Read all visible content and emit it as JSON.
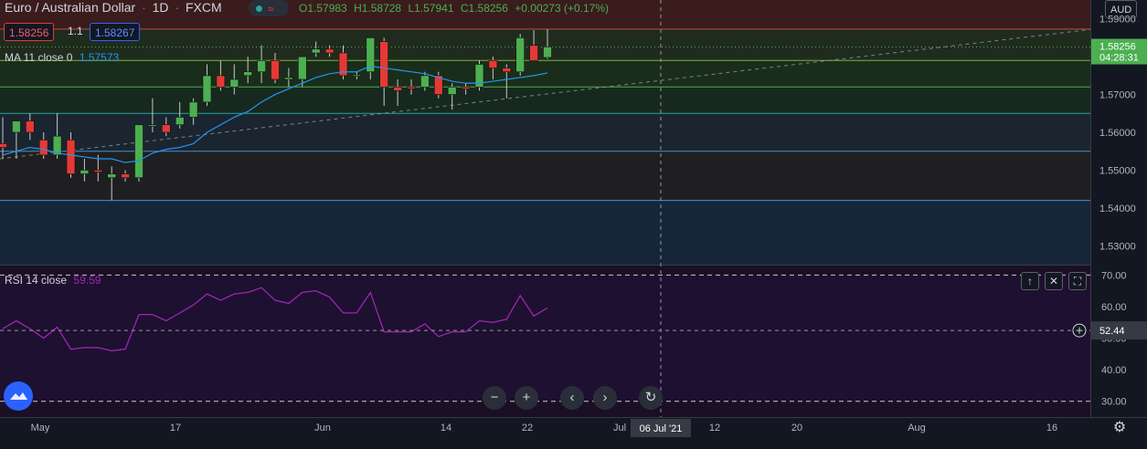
{
  "header": {
    "symbol": "Euro / Australian Dollar",
    "interval": "1D",
    "exchange": "FXCM",
    "ohlc": {
      "o": "O1.57983",
      "h": "H1.58728",
      "l": "L1.57941",
      "c": "C1.58256",
      "chg": "+0.00273 (+0.17%)"
    },
    "bid": "1.58256",
    "spread": "1.1",
    "ask": "1.58267",
    "currency": "AUD"
  },
  "ma_legend": {
    "label": "MA 11 close 0",
    "value": "1.57573"
  },
  "rsi_legend": {
    "label": "RSI 14 close",
    "value": "59.59"
  },
  "price_axis": {
    "last_price": "1.58256",
    "countdown": "04:28:31"
  },
  "rsi_axis": {
    "crosshair_value": "52.44"
  },
  "time_axis": {
    "crosshair_label": "06 Jul '21"
  },
  "colors": {
    "up": "#4caf50",
    "down": "#e53935",
    "ma": "#2196f3",
    "rsi": "#9c27b0",
    "bg": "#131722"
  },
  "icons": [
    "chevrons-up-icon",
    "close-icon",
    "maximize-icon",
    "zoom-out-icon",
    "zoom-in-icon",
    "scroll-left-icon",
    "scroll-right-icon",
    "reset-icon",
    "settings-icon",
    "logo-icon"
  ],
  "chart_data": [
    {
      "type": "candlestick",
      "title": "Euro / Australian Dollar, 1D, FXCM",
      "ylim": [
        1.525,
        1.595
      ],
      "y_ticks": [
        "1.59000",
        "1.58000",
        "1.57000",
        "1.56000",
        "1.55000",
        "1.54000",
        "1.53000"
      ],
      "x_ticks": [
        "May",
        "17",
        "Jun",
        "14",
        "22",
        "Jul",
        "12",
        "20",
        "Aug",
        "16"
      ],
      "candles": [
        {
          "o": 1.557,
          "h": 1.564,
          "l": 1.553,
          "c": 1.556
        },
        {
          "o": 1.56,
          "h": 1.562,
          "l": 1.553,
          "c": 1.563
        },
        {
          "o": 1.563,
          "h": 1.565,
          "l": 1.558,
          "c": 1.56
        },
        {
          "o": 1.558,
          "h": 1.56,
          "l": 1.553,
          "c": 1.554
        },
        {
          "o": 1.554,
          "h": 1.565,
          "l": 1.553,
          "c": 1.559
        },
        {
          "o": 1.558,
          "h": 1.56,
          "l": 1.548,
          "c": 1.549
        },
        {
          "o": 1.549,
          "h": 1.553,
          "l": 1.547,
          "c": 1.55
        },
        {
          "o": 1.55,
          "h": 1.554,
          "l": 1.547,
          "c": 1.5495
        },
        {
          "o": 1.548,
          "h": 1.551,
          "l": 1.542,
          "c": 1.549
        },
        {
          "o": 1.549,
          "h": 1.55,
          "l": 1.547,
          "c": 1.548
        },
        {
          "o": 1.548,
          "h": 1.562,
          "l": 1.547,
          "c": 1.562
        },
        {
          "o": 1.562,
          "h": 1.569,
          "l": 1.56,
          "c": 1.562
        },
        {
          "o": 1.562,
          "h": 1.564,
          "l": 1.559,
          "c": 1.56
        },
        {
          "o": 1.562,
          "h": 1.568,
          "l": 1.561,
          "c": 1.564
        },
        {
          "o": 1.564,
          "h": 1.569,
          "l": 1.562,
          "c": 1.568
        },
        {
          "o": 1.568,
          "h": 1.578,
          "l": 1.567,
          "c": 1.575
        },
        {
          "o": 1.575,
          "h": 1.579,
          "l": 1.571,
          "c": 1.572
        },
        {
          "o": 1.572,
          "h": 1.578,
          "l": 1.57,
          "c": 1.574
        },
        {
          "o": 1.575,
          "h": 1.58,
          "l": 1.573,
          "c": 1.576
        },
        {
          "o": 1.576,
          "h": 1.583,
          "l": 1.573,
          "c": 1.579
        },
        {
          "o": 1.579,
          "h": 1.581,
          "l": 1.573,
          "c": 1.574
        },
        {
          "o": 1.574,
          "h": 1.577,
          "l": 1.572,
          "c": 1.5745
        },
        {
          "o": 1.574,
          "h": 1.58,
          "l": 1.572,
          "c": 1.58
        },
        {
          "o": 1.581,
          "h": 1.584,
          "l": 1.58,
          "c": 1.582
        },
        {
          "o": 1.582,
          "h": 1.583,
          "l": 1.58,
          "c": 1.581
        },
        {
          "o": 1.581,
          "h": 1.583,
          "l": 1.574,
          "c": 1.575
        },
        {
          "o": 1.575,
          "h": 1.576,
          "l": 1.574,
          "c": 1.5752
        },
        {
          "o": 1.576,
          "h": 1.585,
          "l": 1.574,
          "c": 1.585
        },
        {
          "o": 1.584,
          "h": 1.585,
          "l": 1.567,
          "c": 1.572
        },
        {
          "o": 1.572,
          "h": 1.574,
          "l": 1.567,
          "c": 1.571
        },
        {
          "o": 1.572,
          "h": 1.574,
          "l": 1.57,
          "c": 1.5715
        },
        {
          "o": 1.572,
          "h": 1.576,
          "l": 1.571,
          "c": 1.575
        },
        {
          "o": 1.575,
          "h": 1.576,
          "l": 1.569,
          "c": 1.57
        },
        {
          "o": 1.57,
          "h": 1.573,
          "l": 1.566,
          "c": 1.572
        },
        {
          "o": 1.572,
          "h": 1.573,
          "l": 1.57,
          "c": 1.5715
        },
        {
          "o": 1.572,
          "h": 1.579,
          "l": 1.571,
          "c": 1.578
        },
        {
          "o": 1.579,
          "h": 1.58,
          "l": 1.574,
          "c": 1.577
        },
        {
          "o": 1.577,
          "h": 1.578,
          "l": 1.569,
          "c": 1.576
        },
        {
          "o": 1.576,
          "h": 1.586,
          "l": 1.575,
          "c": 1.585
        },
        {
          "o": 1.583,
          "h": 1.587,
          "l": 1.579,
          "c": 1.579
        },
        {
          "o": 1.5798,
          "h": 1.5873,
          "l": 1.5794,
          "c": 1.5826
        }
      ],
      "ma": [
        1.554,
        1.555,
        1.556,
        1.5555,
        1.5545,
        1.554,
        1.5535,
        1.553,
        1.553,
        1.552,
        1.5525,
        1.5545,
        1.5555,
        1.556,
        1.557,
        1.56,
        1.562,
        1.564,
        1.5655,
        1.568,
        1.57,
        1.5715,
        1.573,
        1.5745,
        1.5755,
        1.576,
        1.576,
        1.5775,
        1.577,
        1.5765,
        1.576,
        1.5755,
        1.5745,
        1.5735,
        1.573,
        1.573,
        1.5735,
        1.574,
        1.5745,
        1.575,
        1.5757
      ]
    },
    {
      "type": "line",
      "title": "RSI 14 close",
      "ylim": [
        25,
        73
      ],
      "y_ticks": [
        "70.00",
        "60.00",
        "50.00",
        "40.00",
        "30.00"
      ],
      "levels": [
        70,
        30
      ],
      "values": [
        53,
        55.5,
        53,
        50,
        53.5,
        46.5,
        47,
        47,
        46,
        46.5,
        57.5,
        57.5,
        55.5,
        58,
        60.5,
        64,
        62,
        64,
        64.5,
        66,
        62,
        61,
        64.5,
        65,
        63,
        58,
        58,
        64.5,
        52,
        52,
        52,
        54.5,
        50.5,
        52,
        52,
        55.5,
        55,
        56,
        63.5,
        57,
        59.59
      ]
    }
  ]
}
